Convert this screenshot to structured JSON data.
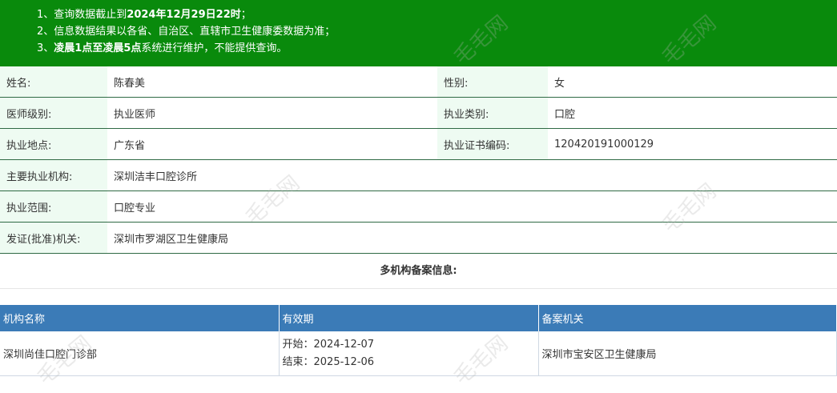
{
  "notice": {
    "line1_prefix": "1、查询数据截止到",
    "line1_bold": "2024年12月29日22时",
    "line1_suffix": "；",
    "line2": "2、信息数据结果以各省、自治区、直辖市卫生健康委数据为准；",
    "line3_prefix": "3、",
    "line3_bold": "凌晨1点至凌晨5点",
    "line3_suffix": "系统进行维护，不能提供查询。"
  },
  "doctor": {
    "name_label": "姓名:",
    "name": "陈春美",
    "gender_label": "性别:",
    "gender": "女",
    "level_label": "医师级别:",
    "level": "执业医师",
    "category_label": "执业类别:",
    "category": "口腔",
    "location_label": "执业地点:",
    "location": "广东省",
    "cert_label": "执业证书编码:",
    "cert": "120420191000129",
    "institution_label": "主要执业机构:",
    "institution": "深圳洁丰口腔诊所",
    "scope_label": "执业范围:",
    "scope": "口腔专业",
    "issuer_label": "发证(批准)机关:",
    "issuer": "深圳市罗湖区卫生健康局"
  },
  "multi": {
    "title": "多机构备案信息:",
    "headers": [
      "机构名称",
      "有效期",
      "备案机关"
    ],
    "rows": [
      {
        "org": "深圳尚佳口腔门诊部",
        "start": "开始：2024-12-07",
        "end": "结束：2025-12-06",
        "authority": "深圳市宝安区卫生健康局"
      }
    ]
  },
  "watermark": "毛毛网",
  "colors": {
    "banner": "#098a0c",
    "header": "#3b7bb7",
    "label_bg": "#eefbf2"
  }
}
